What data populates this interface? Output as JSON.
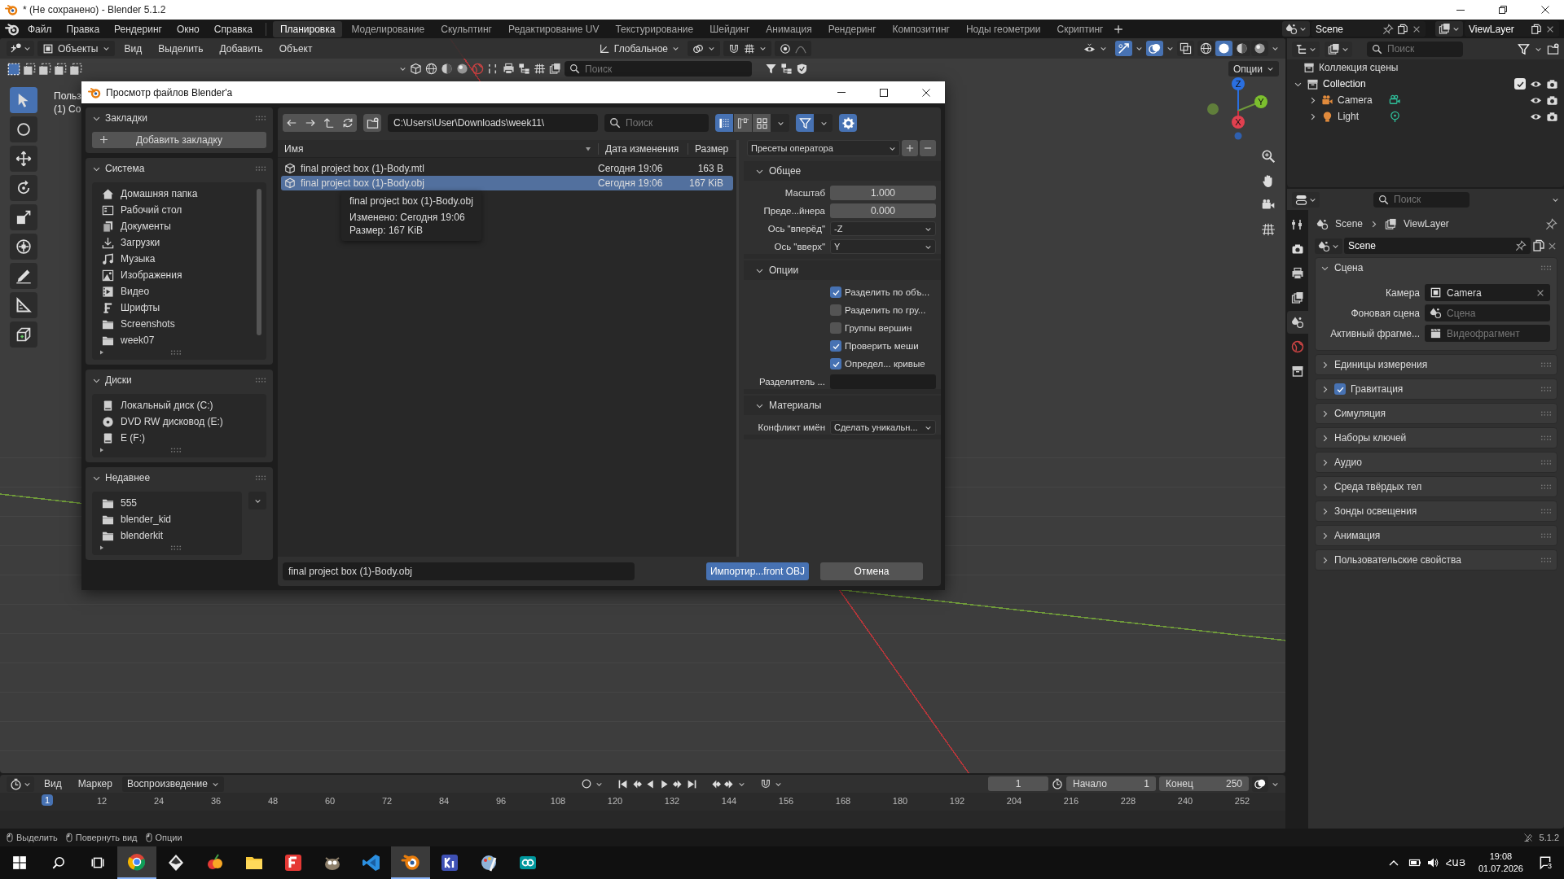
{
  "app_window": {
    "title": "* (Не сохранено) - Blender 5.1.2"
  },
  "menu": [
    "Файл",
    "Правка",
    "Рендеринг",
    "Окно",
    "Справка"
  ],
  "workspaces": [
    {
      "label": "Планировка",
      "selected": true
    },
    {
      "label": "Моделирование",
      "selected": false
    },
    {
      "label": "Скульптинг",
      "selected": false
    },
    {
      "label": "Редактирование UV",
      "selected": false
    },
    {
      "label": "Текстурирование",
      "selected": false
    },
    {
      "label": "Шейдинг",
      "selected": false
    },
    {
      "label": "Анимация",
      "selected": false
    },
    {
      "label": "Рендеринг",
      "selected": false
    },
    {
      "label": "Композитинг",
      "selected": false
    },
    {
      "label": "Ноды геометрии",
      "selected": false
    },
    {
      "label": "Скриптинг",
      "selected": false
    }
  ],
  "scene_selector": {
    "scene": "Scene",
    "view_layer": "ViewLayer"
  },
  "viewport_header": {
    "mode": "Объекты",
    "menus": [
      "Вид",
      "Выделить",
      "Добавить",
      "Объект"
    ],
    "orientation": "Глобальное",
    "gizmos_on": true,
    "overlays_on": true,
    "shading": [
      {
        "selected": false
      },
      {
        "selected": true
      },
      {
        "selected": false
      },
      {
        "selected": false
      }
    ]
  },
  "tool_header": {
    "search_placeholder": "Поиск",
    "options": "Опции"
  },
  "viewport": {
    "overlay_text": [
      "Польз",
      "(1) Co"
    ],
    "gizmo_axes": [
      "Z",
      "Y",
      "X"
    ]
  },
  "file_dialog": {
    "title": "Просмотр файлов Blender'a",
    "bookmarks": {
      "title": "Закладки",
      "expanded": true,
      "add_button": "Добавить закладку"
    },
    "system": {
      "title": "Система",
      "expanded": true,
      "items": [
        {
          "label": "Домашняя папка",
          "kind": "home"
        },
        {
          "label": "Рабочий стол",
          "kind": "desktop"
        },
        {
          "label": "Документы",
          "kind": "documents"
        },
        {
          "label": "Загрузки",
          "kind": "download"
        },
        {
          "label": "Музыка",
          "kind": "music"
        },
        {
          "label": "Изображения",
          "kind": "image"
        },
        {
          "label": "Видео",
          "kind": "video"
        },
        {
          "label": "Шрифты",
          "kind": "font"
        },
        {
          "label": "Screenshots",
          "kind": "folder"
        },
        {
          "label": "week07",
          "kind": "folder"
        }
      ]
    },
    "drives": {
      "title": "Диски",
      "expanded": true,
      "items": [
        {
          "label": "Локальный диск (C:)",
          "kind": "disk"
        },
        {
          "label": "DVD RW дисковод (E:)",
          "kind": "disc"
        },
        {
          "label": "E (F:)",
          "kind": "disk"
        }
      ]
    },
    "recent": {
      "title": "Недавнее",
      "expanded": true,
      "items": [
        {
          "label": "555",
          "kind": "folder"
        },
        {
          "label": "blender_kid",
          "kind": "folder"
        },
        {
          "label": "blenderkit",
          "kind": "folder"
        }
      ]
    },
    "path": "C:\\Users\\User\\Downloads\\week11\\",
    "search_placeholder": "Поиск",
    "display_modes": [
      {
        "selected": true
      },
      {
        "selected": false
      },
      {
        "selected": false
      }
    ],
    "filter_on": true,
    "settings_on": true,
    "columns": [
      "Имя",
      "Дата изменения",
      "Размер"
    ],
    "files": [
      {
        "name": "final project box (1)-Body.mtl",
        "modified": "Сегодня 19:06",
        "size": "163 B",
        "selected": false
      },
      {
        "name": "final project box (1)-Body.obj",
        "modified": "Сегодня 19:06",
        "size": "167 KiB",
        "selected": true
      }
    ],
    "tooltip": [
      "final project box (1)-Body.obj",
      "Изменено: Сегодня 19:06",
      "Размер: 167 KiB"
    ],
    "filename": "final project box (1)-Body.obj",
    "import_button": "Импортир...front OBJ",
    "cancel_button": "Отмена",
    "presets": "Пресеты оператора",
    "sections": [
      {
        "title": "Общее",
        "expanded": true,
        "rows": [
          {
            "kind": "number",
            "label": "Масштаб",
            "value": "1.000"
          },
          {
            "kind": "number",
            "label": "Преде...йнера",
            "value": "0.000"
          },
          {
            "kind": "dropdown",
            "label": "Ось \"вперёд\"",
            "value": "-Z"
          },
          {
            "kind": "dropdown",
            "label": "Ось \"вверх\"",
            "value": "Y"
          }
        ]
      },
      {
        "title": "Опции",
        "expanded": true,
        "rows": [
          {
            "kind": "checkbox",
            "label": "Разделить по объ...",
            "checked": true
          },
          {
            "kind": "checkbox",
            "label": "Разделить по гру...",
            "checked": false
          },
          {
            "kind": "checkbox",
            "label": "Группы вершин",
            "checked": false
          },
          {
            "kind": "checkbox",
            "label": "Проверить меши",
            "checked": true
          },
          {
            "kind": "checkbox",
            "label": "Определ... кривые",
            "checked": true
          },
          {
            "kind": "text",
            "label": "Разделитель ..."
          }
        ]
      },
      {
        "title": "Материалы",
        "expanded": true,
        "rows": [
          {
            "kind": "dropdown",
            "label": "Конфликт имён",
            "value": "Сделать уникальн..."
          }
        ]
      }
    ]
  },
  "outliner": {
    "search_placeholder": "Поиск",
    "root": "Коллекция сцены",
    "tree": [
      {
        "label": "Collection",
        "kind": "collection",
        "expanded": true,
        "checked": true,
        "children": [
          {
            "label": "Camera",
            "kind": "camera",
            "expanded": false
          },
          {
            "label": "Light",
            "kind": "light",
            "expanded": false
          }
        ]
      }
    ]
  },
  "properties": {
    "search_placeholder": "Поиск",
    "breadcrumb": [
      "Scene",
      "ViewLayer"
    ],
    "scene_field": "Scene",
    "tabs": [
      {
        "kind": "tool",
        "selected": false
      },
      {
        "kind": "render",
        "selected": false
      },
      {
        "kind": "output",
        "selected": false
      },
      {
        "kind": "view_layer",
        "selected": false
      },
      {
        "kind": "scene",
        "selected": true
      },
      {
        "kind": "world",
        "selected": false
      },
      {
        "kind": "collection",
        "selected": false
      }
    ],
    "panels": [
      {
        "title": "Сцена",
        "expanded": true,
        "fields": [
          {
            "label": "Камера",
            "value": "Camera"
          },
          {
            "label": "Фоновая сцена",
            "placeholder": "Сцена"
          },
          {
            "label": "Активный фрагме...",
            "placeholder": "Видеофрагмент"
          }
        ]
      },
      {
        "title": "Единицы измерения",
        "expanded": false
      },
      {
        "title": "Гравитация",
        "expanded": false,
        "checked": true
      },
      {
        "title": "Симуляция",
        "expanded": false
      },
      {
        "title": "Наборы ключей",
        "expanded": false
      },
      {
        "title": "Аудио",
        "expanded": false
      },
      {
        "title": "Среда твёрдых тел",
        "expanded": false
      },
      {
        "title": "Зонды освещения",
        "expanded": false
      },
      {
        "title": "Анимация",
        "expanded": false
      },
      {
        "title": "Пользовательские свойства",
        "expanded": false
      }
    ]
  },
  "timeline": {
    "menus": [
      "Вид",
      "Маркер"
    ],
    "playback": "Воспроизведение",
    "current_frame": "1",
    "start_label": "Начало",
    "start": "1",
    "end_label": "Конец",
    "end": "250",
    "playhead": "1",
    "ticks": [
      "12",
      "24",
      "36",
      "48",
      "60",
      "72",
      "84",
      "96",
      "108",
      "120",
      "132",
      "144",
      "156",
      "168",
      "180",
      "192",
      "204",
      "216",
      "228",
      "240",
      "252"
    ]
  },
  "status_bar": {
    "items": [
      "Выделить",
      "Повернуть вид",
      "Опции"
    ],
    "version": "5.1.2"
  },
  "taskbar": {
    "apps": [
      {
        "active": true
      },
      {
        "active": false
      },
      {
        "active": false
      },
      {
        "active": false
      },
      {
        "active": false
      },
      {
        "active": false
      },
      {
        "active": false
      },
      {
        "active": true
      },
      {
        "active": false
      },
      {
        "active": false
      },
      {
        "active": false
      }
    ],
    "language": "ՀԱՅ",
    "time": "19:08",
    "date": "01.07.2026",
    "notifications": "3"
  }
}
